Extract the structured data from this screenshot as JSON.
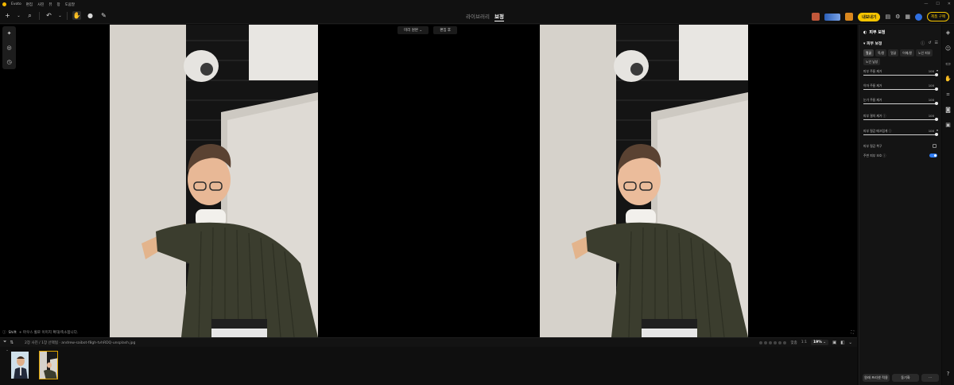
{
  "app": {
    "name": "Evoto",
    "menu": [
      "편집",
      "사진",
      "뷰",
      "창",
      "도움말"
    ]
  },
  "toolbar": {
    "left_icons": [
      "add-icon",
      "search-icon",
      "undo-icon",
      "hand-icon",
      "brush-icon",
      "pen-icon"
    ],
    "tabs": [
      {
        "label": "라이브러리",
        "active": false
      },
      {
        "label": "보정",
        "active": true
      }
    ],
    "export_label": "내보내기",
    "buy_label": "제품 구매"
  },
  "canvas": {
    "compare_before": "미리 원본",
    "compare_after": "편집 후",
    "hint_prefix": "Shift",
    "hint_text": "+ 마우스 휠로 이미지 확대/축소합니다."
  },
  "filmbar": {
    "info": "2장 사진 / 1장 선택됨 · andrew-saibot-f8gh-tvhRDQ-unsplash.jpg",
    "fit_label": "맞춤",
    "ratio_label": "1:1",
    "zoom": "19%"
  },
  "right_panel": {
    "header": "피부 보정",
    "section_title": "피부 보정",
    "chips": [
      {
        "label": "얼굴",
        "selected": true
      },
      {
        "label": "목/팔",
        "selected": false
      },
      {
        "label": "얼굴",
        "selected": false
      },
      {
        "label": "어깨/팔",
        "selected": false
      },
      {
        "label": "노인 피부",
        "selected": false
      },
      {
        "label": "노인 남성",
        "selected": false
      }
    ],
    "sliders": [
      {
        "name": "피부 주름 제거",
        "value": 100,
        "max": 100,
        "caret": true
      },
      {
        "name": "이마 주름 제거",
        "value": 100,
        "max": 100,
        "caret": false
      },
      {
        "name": "눈가 주름 제거",
        "value": 100,
        "max": 100,
        "caret": false
      },
      {
        "name": "피부 결의 제거 ⓘ",
        "value": 100,
        "max": 100,
        "caret": false
      },
      {
        "name": "피부 질감 매끄럽게 ⓘ",
        "value": 100,
        "max": 100,
        "caret": true
      }
    ],
    "options": [
      {
        "name": "피부 질감 복구",
        "type": "checkbox"
      },
      {
        "name": "주변 피부 보호 ⓘ",
        "type": "toggle"
      }
    ],
    "reset_label": "원래 프리셋 적용",
    "sync_label": "동기화",
    "more_label": "⋯"
  },
  "colors": {
    "accent": "#f5c400",
    "toggle_on": "#2e7cf6",
    "selected_thumb": "#e0a400"
  }
}
